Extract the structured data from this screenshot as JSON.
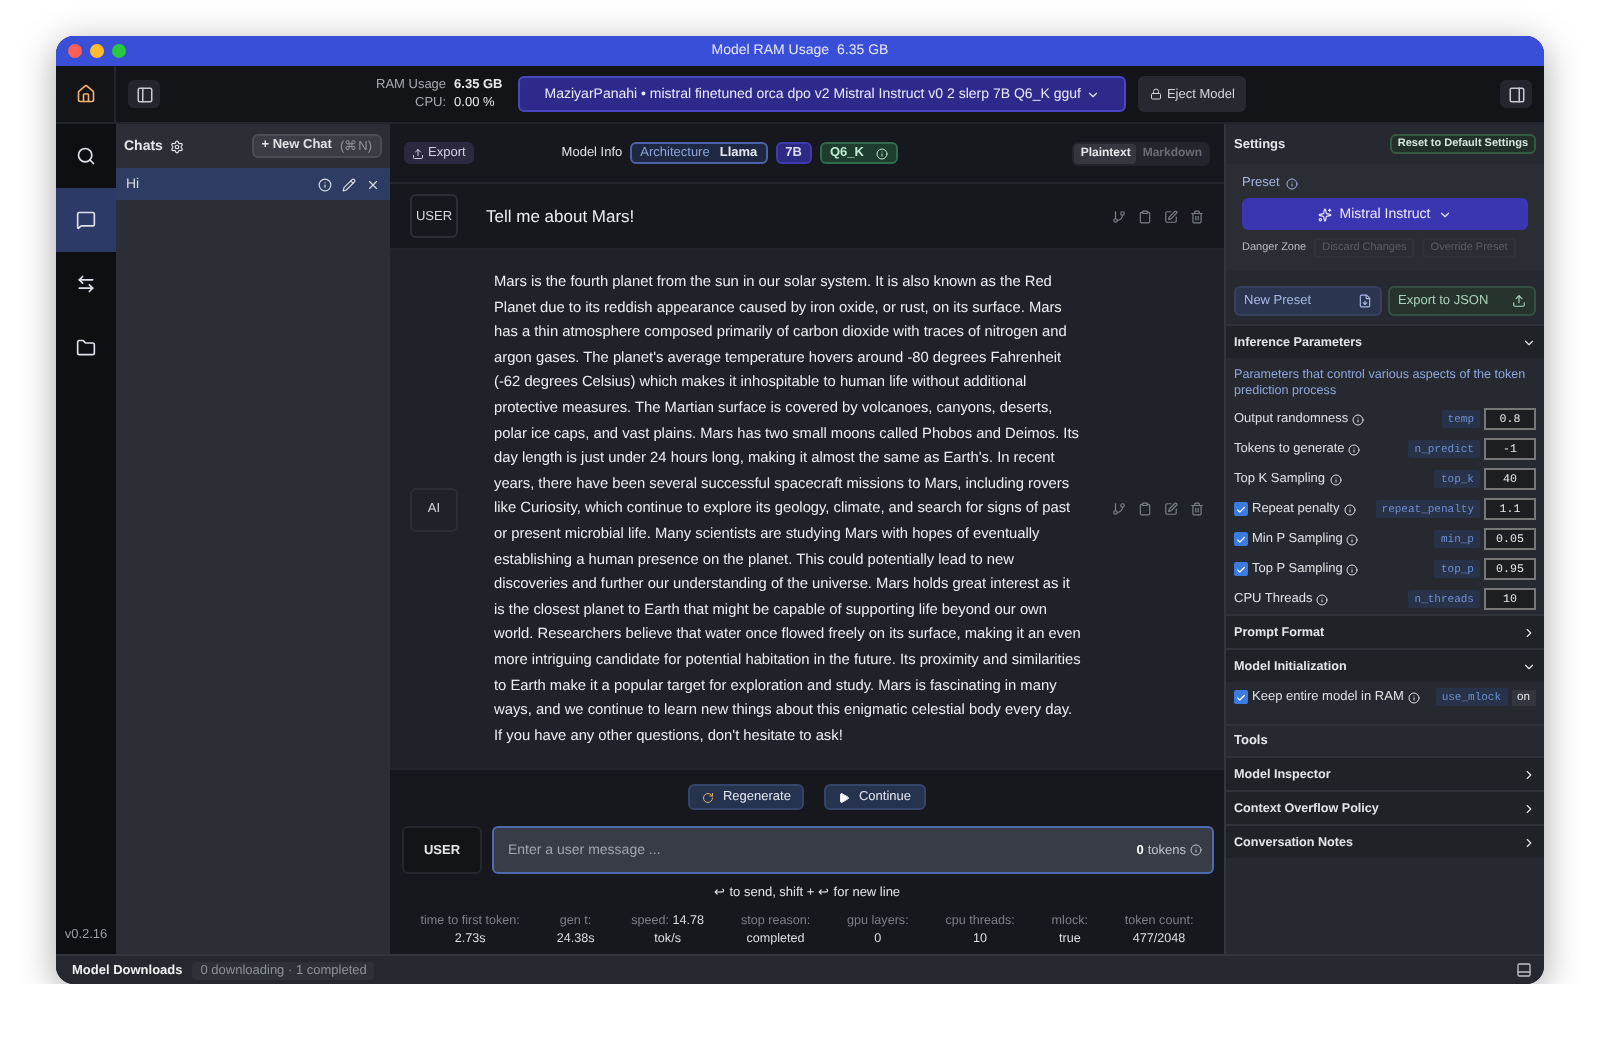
{
  "window": {
    "title": "Model RAM Usage",
    "ram": "6.35 GB"
  },
  "rail": [
    {
      "kind": "home",
      "selected": false
    },
    {
      "kind": "search",
      "selected": false
    },
    {
      "kind": "chat",
      "selected": true
    },
    {
      "kind": "swap",
      "selected": false
    },
    {
      "kind": "folder",
      "selected": false
    }
  ],
  "version": "v0.2.16",
  "toolbar": {
    "ram_label": "RAM Usage",
    "ram_value": "6.35 GB",
    "cpu_label": "CPU:",
    "cpu_value": "0.00 %",
    "model": "MaziyarPanahi • mistral finetuned orca dpo v2 Mistral Instruct v0 2 slerp 7B Q6_K gguf",
    "eject": "Eject Model"
  },
  "chats": {
    "title": "Chats",
    "new_chat": "+ New Chat",
    "shortcut": "(⌘N)",
    "items": [
      {
        "name": "Hi",
        "selected": true
      }
    ]
  },
  "header": {
    "export": "Export",
    "model_info": "Model Info",
    "arch_label": "Architecture",
    "arch_value": "Llama",
    "size": "7B",
    "quant": "Q6_K",
    "format_tabs": [
      {
        "label": "Plaintext",
        "selected": true
      },
      {
        "label": "Markdown",
        "selected": false
      }
    ]
  },
  "messages": [
    {
      "role": "USER",
      "text": "Tell me about Mars!"
    },
    {
      "role": "AI",
      "text": "Mars is the fourth planet from the sun in our solar system. It is also known as the Red Planet due to its reddish appearance caused by iron oxide, or rust, on its surface. Mars has a thin atmosphere composed primarily of carbon dioxide with traces of nitrogen and argon gases. The planet's average temperature hovers around -80 degrees Fahrenheit (-62 degrees Celsius) which makes it inhospitable to human life without additional protective measures. The Martian surface is covered by volcanoes, canyons, deserts, polar ice caps, and vast plains. Mars has two small moons called Phobos and Deimos. Its day length is just under 24 hours long, making it almost the same as Earth's. In recent years, there have been several successful spacecraft missions to Mars, including rovers like Curiosity, which continue to explore its geology, climate, and search for signs of past or present microbial life. Many scientists are studying Mars with hopes of eventually establishing a human presence on the planet. This could potentially lead to new discoveries and further our understanding of the universe. Mars holds great interest as it is the closest planet to Earth that might be capable of supporting life beyond our own world. Researchers believe that water once flowed freely on its surface, making it an even more intriguing candidate for potential habitation in the future. Its proximity and similarities to Earth make it a popular target for exploration and study. Mars is fascinating in many ways, and we continue to learn new things about this enigmatic celestial body every day. If you have any other questions, don't hesitate to ask!"
    }
  ],
  "actions": [
    {
      "kind": "regenerate",
      "label": "Regenerate"
    },
    {
      "kind": "continue",
      "label": "Continue"
    }
  ],
  "composer": {
    "role": "USER",
    "placeholder": "Enter a user message ...",
    "tokens": "0",
    "tokens_label": "tokens"
  },
  "hint": "↩ to send, shift + ↩ for new line",
  "stats": [
    {
      "label": "time to first token:",
      "value": "2.73s"
    },
    {
      "label": "gen t:",
      "value": "24.38s"
    },
    {
      "label": "speed:",
      "extra": "14.78",
      "value": "tok/s"
    },
    {
      "label": "stop reason:",
      "value": "completed"
    },
    {
      "label": "gpu layers:",
      "value": "0"
    },
    {
      "label": "cpu threads:",
      "value": "10"
    },
    {
      "label": "mlock:",
      "value": "true"
    },
    {
      "label": "token count:",
      "value": "477/2048"
    }
  ],
  "settings": {
    "title": "Settings",
    "reset": "Reset to Default Settings",
    "preset_label": "Preset",
    "preset": "Mistral Instruct",
    "danger_zone": "Danger Zone",
    "discard": "Discard Changes",
    "override": "Override Preset",
    "new_preset": "New Preset",
    "export_json": "Export to JSON"
  },
  "sections": [
    {
      "title": "Inference Parameters",
      "expanded": true,
      "description": "Parameters that control various aspects of the token prediction process",
      "params": [
        {
          "kind": "plain",
          "label": "Output randomness",
          "key": "temp",
          "value": "0.8"
        },
        {
          "kind": "plain",
          "label": "Tokens to generate",
          "key": "n_predict",
          "value": "-1"
        },
        {
          "kind": "plain",
          "label": "Top K Sampling",
          "key": "top_k",
          "value": "40"
        },
        {
          "kind": "checkbox",
          "checked": true,
          "label": "Repeat penalty",
          "key": "repeat_penalty",
          "value": "1.1"
        },
        {
          "kind": "checkbox",
          "checked": true,
          "label": "Min P Sampling",
          "key": "min_p",
          "value": "0.05"
        },
        {
          "kind": "checkbox",
          "checked": true,
          "label": "Top P Sampling",
          "key": "top_p",
          "value": "0.95"
        },
        {
          "kind": "plain",
          "label": "CPU Threads",
          "key": "n_threads",
          "value": "10"
        }
      ]
    },
    {
      "title": "Prompt Format",
      "expanded": false
    },
    {
      "title": "Model Initialization",
      "expanded": true,
      "params": [
        {
          "kind": "toggle",
          "checked": true,
          "label": "Keep entire model in RAM",
          "key": "use_mlock",
          "value": "on"
        }
      ]
    }
  ],
  "tools": {
    "title": "Tools",
    "items": [
      "Model Inspector",
      "Context Overflow Policy",
      "Conversation Notes"
    ]
  },
  "bottom": {
    "title": "Model Downloads",
    "status": "0 downloading · 1 completed"
  }
}
